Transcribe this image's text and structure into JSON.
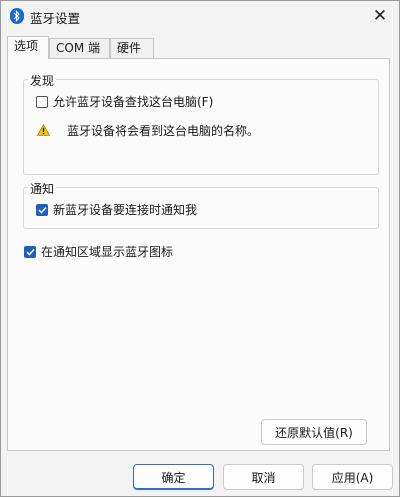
{
  "window": {
    "title": "蓝牙设置",
    "icon": "bluetooth-icon",
    "close_icon": "close-icon"
  },
  "tabs": [
    {
      "label": "选项",
      "active": true
    },
    {
      "label": "COM 端口",
      "active": false
    },
    {
      "label": "硬件",
      "active": false
    }
  ],
  "discovery": {
    "legend": "发现",
    "allow_label": "允许蓝牙设备查找这台电脑(F)",
    "allow_checked": false,
    "warning_text": "蓝牙设备将会看到这台电脑的名称。",
    "warning_icon": "warning-icon"
  },
  "notify": {
    "legend": "通知",
    "new_device_label": "新蓝牙设备要连接时通知我",
    "new_device_checked": true
  },
  "tray": {
    "label": "在通知区域显示蓝牙图标",
    "checked": true
  },
  "buttons": {
    "restore": "还原默认值(R)",
    "ok": "确定",
    "cancel": "取消",
    "apply": "应用(A)"
  },
  "colors": {
    "accent": "#1f5fbf",
    "warning": "#f2c300"
  }
}
